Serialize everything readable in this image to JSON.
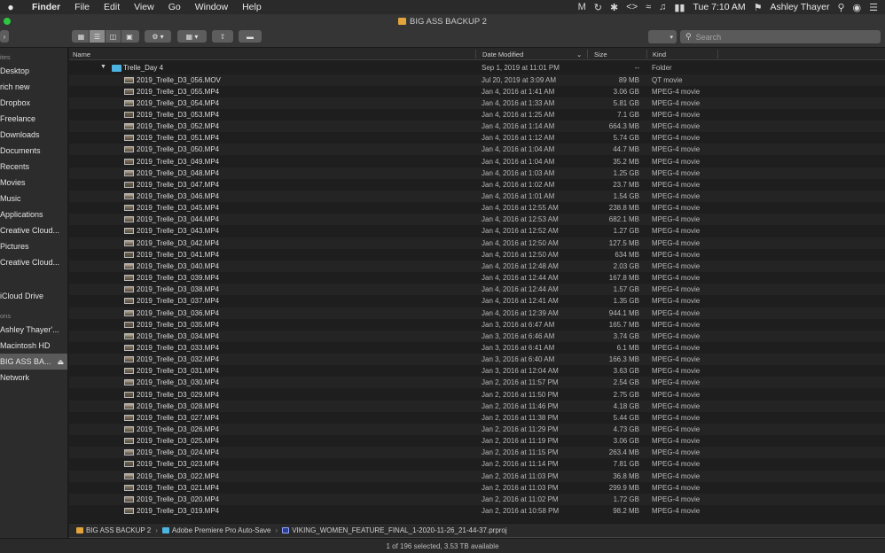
{
  "menubar": {
    "apple": "",
    "app": "Finder",
    "items": [
      "File",
      "Edit",
      "View",
      "Go",
      "Window",
      "Help"
    ],
    "status_icons": [
      "malwarebytes-icon",
      "time-machine-icon",
      "bluetooth-icon",
      "script-editor-icon",
      "wifi-icon",
      "volume-icon",
      "battery-icon"
    ],
    "clock": "Tue 7:10 AM",
    "user": "Ashley Thayer"
  },
  "window": {
    "title": "BIG ASS BACKUP 2"
  },
  "search": {
    "placeholder": "Search"
  },
  "sidebar": {
    "headers": [
      "ites",
      "ons"
    ],
    "items": [
      {
        "label": "Desktop"
      },
      {
        "label": "rich new"
      },
      {
        "label": "Dropbox"
      },
      {
        "label": "Freelance"
      },
      {
        "label": "Downloads"
      },
      {
        "label": "Documents"
      },
      {
        "label": "Recents"
      },
      {
        "label": "Movies"
      },
      {
        "label": "Music"
      },
      {
        "label": "Applications"
      },
      {
        "label": "Creative Cloud..."
      },
      {
        "label": "Pictures"
      },
      {
        "label": "Creative Cloud..."
      },
      {
        "label": "iCloud Drive"
      },
      {
        "label": "Ashley Thayer'..."
      },
      {
        "label": "Macintosh HD"
      },
      {
        "label": "BIG ASS BA..."
      },
      {
        "label": "Network"
      }
    ]
  },
  "columns": {
    "name": "Name",
    "date": "Date Modified",
    "size": "Size",
    "kind": "Kind"
  },
  "folder_row": {
    "name": "Trelle_Day 4",
    "date": "Sep 1, 2019 at 11:01 PM",
    "size": "--",
    "kind": "Folder"
  },
  "files": [
    {
      "name": "2019_Trelle_D3_056.MOV",
      "date": "Jul 20, 2019 at 3:09 AM",
      "size": "89 MB",
      "kind": "QT movie"
    },
    {
      "name": "2019_Trelle_D3_055.MP4",
      "date": "Jan 4, 2016 at 1:41 AM",
      "size": "3.06 GB",
      "kind": "MPEG-4 movie"
    },
    {
      "name": "2019_Trelle_D3_054.MP4",
      "date": "Jan 4, 2016 at 1:33 AM",
      "size": "5.81 GB",
      "kind": "MPEG-4 movie"
    },
    {
      "name": "2019_Trelle_D3_053.MP4",
      "date": "Jan 4, 2016 at 1:25 AM",
      "size": "7.1 GB",
      "kind": "MPEG-4 movie"
    },
    {
      "name": "2019_Trelle_D3_052.MP4",
      "date": "Jan 4, 2016 at 1:14 AM",
      "size": "664.3 MB",
      "kind": "MPEG-4 movie"
    },
    {
      "name": "2019_Trelle_D3_051.MP4",
      "date": "Jan 4, 2016 at 1:12 AM",
      "size": "5.74 GB",
      "kind": "MPEG-4 movie"
    },
    {
      "name": "2019_Trelle_D3_050.MP4",
      "date": "Jan 4, 2016 at 1:04 AM",
      "size": "44.7 MB",
      "kind": "MPEG-4 movie"
    },
    {
      "name": "2019_Trelle_D3_049.MP4",
      "date": "Jan 4, 2016 at 1:04 AM",
      "size": "35.2 MB",
      "kind": "MPEG-4 movie"
    },
    {
      "name": "2019_Trelle_D3_048.MP4",
      "date": "Jan 4, 2016 at 1:03 AM",
      "size": "1.25 GB",
      "kind": "MPEG-4 movie"
    },
    {
      "name": "2019_Trelle_D3_047.MP4",
      "date": "Jan 4, 2016 at 1:02 AM",
      "size": "23.7 MB",
      "kind": "MPEG-4 movie"
    },
    {
      "name": "2019_Trelle_D3_046.MP4",
      "date": "Jan 4, 2016 at 1:01 AM",
      "size": "1.54 GB",
      "kind": "MPEG-4 movie"
    },
    {
      "name": "2019_Trelle_D3_045.MP4",
      "date": "Jan 4, 2016 at 12:55 AM",
      "size": "238.8 MB",
      "kind": "MPEG-4 movie"
    },
    {
      "name": "2019_Trelle_D3_044.MP4",
      "date": "Jan 4, 2016 at 12:53 AM",
      "size": "682.1 MB",
      "kind": "MPEG-4 movie"
    },
    {
      "name": "2019_Trelle_D3_043.MP4",
      "date": "Jan 4, 2016 at 12:52 AM",
      "size": "1.27 GB",
      "kind": "MPEG-4 movie"
    },
    {
      "name": "2019_Trelle_D3_042.MP4",
      "date": "Jan 4, 2016 at 12:50 AM",
      "size": "127.5 MB",
      "kind": "MPEG-4 movie"
    },
    {
      "name": "2019_Trelle_D3_041.MP4",
      "date": "Jan 4, 2016 at 12:50 AM",
      "size": "634 MB",
      "kind": "MPEG-4 movie"
    },
    {
      "name": "2019_Trelle_D3_040.MP4",
      "date": "Jan 4, 2016 at 12:48 AM",
      "size": "2.03 GB",
      "kind": "MPEG-4 movie"
    },
    {
      "name": "2019_Trelle_D3_039.MP4",
      "date": "Jan 4, 2016 at 12:44 AM",
      "size": "167.8 MB",
      "kind": "MPEG-4 movie"
    },
    {
      "name": "2019_Trelle_D3_038.MP4",
      "date": "Jan 4, 2016 at 12:44 AM",
      "size": "1.57 GB",
      "kind": "MPEG-4 movie"
    },
    {
      "name": "2019_Trelle_D3_037.MP4",
      "date": "Jan 4, 2016 at 12:41 AM",
      "size": "1.35 GB",
      "kind": "MPEG-4 movie"
    },
    {
      "name": "2019_Trelle_D3_036.MP4",
      "date": "Jan 4, 2016 at 12:39 AM",
      "size": "944.1 MB",
      "kind": "MPEG-4 movie"
    },
    {
      "name": "2019_Trelle_D3_035.MP4",
      "date": "Jan 3, 2016 at 6:47 AM",
      "size": "165.7 MB",
      "kind": "MPEG-4 movie"
    },
    {
      "name": "2019_Trelle_D3_034.MP4",
      "date": "Jan 3, 2016 at 6:46 AM",
      "size": "3.74 GB",
      "kind": "MPEG-4 movie"
    },
    {
      "name": "2019_Trelle_D3_033.MP4",
      "date": "Jan 3, 2016 at 6:41 AM",
      "size": "6.1 MB",
      "kind": "MPEG-4 movie"
    },
    {
      "name": "2019_Trelle_D3_032.MP4",
      "date": "Jan 3, 2016 at 6:40 AM",
      "size": "166.3 MB",
      "kind": "MPEG-4 movie"
    },
    {
      "name": "2019_Trelle_D3_031.MP4",
      "date": "Jan 3, 2016 at 12:04 AM",
      "size": "3.63 GB",
      "kind": "MPEG-4 movie"
    },
    {
      "name": "2019_Trelle_D3_030.MP4",
      "date": "Jan 2, 2016 at 11:57 PM",
      "size": "2.54 GB",
      "kind": "MPEG-4 movie"
    },
    {
      "name": "2019_Trelle_D3_029.MP4",
      "date": "Jan 2, 2016 at 11:50 PM",
      "size": "2.75 GB",
      "kind": "MPEG-4 movie"
    },
    {
      "name": "2019_Trelle_D3_028.MP4",
      "date": "Jan 2, 2016 at 11:46 PM",
      "size": "4.18 GB",
      "kind": "MPEG-4 movie"
    },
    {
      "name": "2019_Trelle_D3_027.MP4",
      "date": "Jan 2, 2016 at 11:38 PM",
      "size": "5.44 GB",
      "kind": "MPEG-4 movie"
    },
    {
      "name": "2019_Trelle_D3_026.MP4",
      "date": "Jan 2, 2016 at 11:29 PM",
      "size": "4.73 GB",
      "kind": "MPEG-4 movie"
    },
    {
      "name": "2019_Trelle_D3_025.MP4",
      "date": "Jan 2, 2016 at 11:19 PM",
      "size": "3.06 GB",
      "kind": "MPEG-4 movie"
    },
    {
      "name": "2019_Trelle_D3_024.MP4",
      "date": "Jan 2, 2016 at 11:15 PM",
      "size": "263.4 MB",
      "kind": "MPEG-4 movie"
    },
    {
      "name": "2019_Trelle_D3_023.MP4",
      "date": "Jan 2, 2016 at 11:14 PM",
      "size": "7.81 GB",
      "kind": "MPEG-4 movie"
    },
    {
      "name": "2019_Trelle_D3_022.MP4",
      "date": "Jan 2, 2016 at 11:03 PM",
      "size": "36.8 MB",
      "kind": "MPEG-4 movie"
    },
    {
      "name": "2019_Trelle_D3_021.MP4",
      "date": "Jan 2, 2016 at 11:03 PM",
      "size": "299.9 MB",
      "kind": "MPEG-4 movie"
    },
    {
      "name": "2019_Trelle_D3_020.MP4",
      "date": "Jan 2, 2016 at 11:02 PM",
      "size": "1.72 GB",
      "kind": "MPEG-4 movie"
    },
    {
      "name": "2019_Trelle_D3_019.MP4",
      "date": "Jan 2, 2016 at 10:58 PM",
      "size": "98.2 MB",
      "kind": "MPEG-4 movie"
    }
  ],
  "pathbar": {
    "crumbs": [
      "BIG ASS BACKUP 2",
      "Adobe Premiere Pro Auto-Save",
      "VIKING_WOMEN_FEATURE_FINAL_1-2020-11-26_21-44-37.prproj"
    ],
    "colors": [
      "#e2a43b",
      "#4db3e0",
      "#2f3f8f"
    ]
  },
  "status": "1 of 196 selected, 3.53 TB available"
}
